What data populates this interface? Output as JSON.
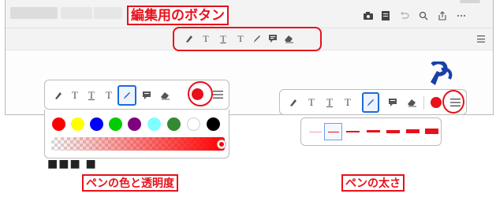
{
  "labels": {
    "edit_buttons": "編集用のボタン",
    "pen_color_opacity": "ペンの色と透明度",
    "pen_thickness": "ペンの太さ"
  },
  "background_text": "■■■ ■",
  "colors": {
    "accent_red": "#e8101a",
    "swatches": [
      "#ff0000",
      "#ffff00",
      "#0000ff",
      "#00cc00",
      "#7f007f",
      "#7fffff",
      "#338a33",
      "#ffffff",
      "#000000"
    ]
  },
  "toolbar_icons": [
    "highlighter-icon",
    "strikethrough-icon",
    "underline-icon",
    "text-icon",
    "pen-icon",
    "comment-icon",
    "eraser-icon"
  ],
  "titlebar_icons": [
    "camera-icon",
    "document-icon",
    "undo-icon",
    "search-icon",
    "share-icon",
    "more-icon"
  ],
  "opacity_slider_value": 1.0,
  "thickness_options": 6,
  "thickness_selected": 1
}
